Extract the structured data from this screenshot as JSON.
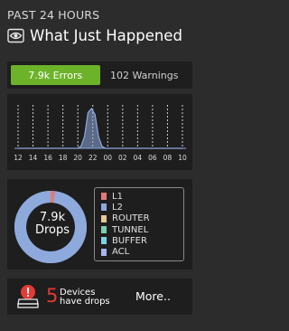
{
  "header": {
    "subtitle": "PAST 24 HOURS",
    "title": "What Just Happened",
    "icon": "eye-icon"
  },
  "tabs": [
    {
      "label": "7.9k Errors",
      "active": true,
      "color": "#6db32a"
    },
    {
      "label": "102 Warnings",
      "active": false
    }
  ],
  "chart_data": [
    {
      "type": "line",
      "x_tick_labels": [
        "12",
        "14",
        "16",
        "18",
        "20",
        "22",
        "00",
        "02",
        "04",
        "06",
        "08",
        "10"
      ],
      "series_color": "#8ea9dc",
      "grid": "vertical dashed lines",
      "peak_at": "between 18 and 20",
      "y": [
        0,
        0,
        0,
        0,
        0,
        0,
        0,
        0,
        0,
        0,
        0,
        0,
        0,
        0,
        0,
        0,
        0,
        0,
        0.05,
        0.3,
        0.9,
        1,
        0.85,
        0.3,
        0.05,
        0,
        0,
        0,
        0,
        0,
        0,
        0,
        0,
        0,
        0,
        0,
        0,
        0,
        0,
        0,
        0,
        0,
        0,
        0,
        0,
        0,
        0,
        0
      ]
    },
    {
      "type": "pie",
      "center_value": "7.9k",
      "center_label": "Drops",
      "labels": [
        "L1",
        "L2",
        "ROUTER",
        "TUNNEL",
        "BUFFER",
        "ACL"
      ],
      "values": [
        0.02,
        0.98,
        0,
        0,
        0,
        0
      ],
      "colors": [
        "#e07a7a",
        "#8ea9dc",
        "#e8c79a",
        "#7bcfae",
        "#7fd1e2",
        "#a8b4f0"
      ]
    }
  ],
  "devices": {
    "count": "5",
    "line1": "Devices",
    "line2": "have drops",
    "icon": "alert-icon"
  },
  "more": {
    "label": "More.."
  }
}
